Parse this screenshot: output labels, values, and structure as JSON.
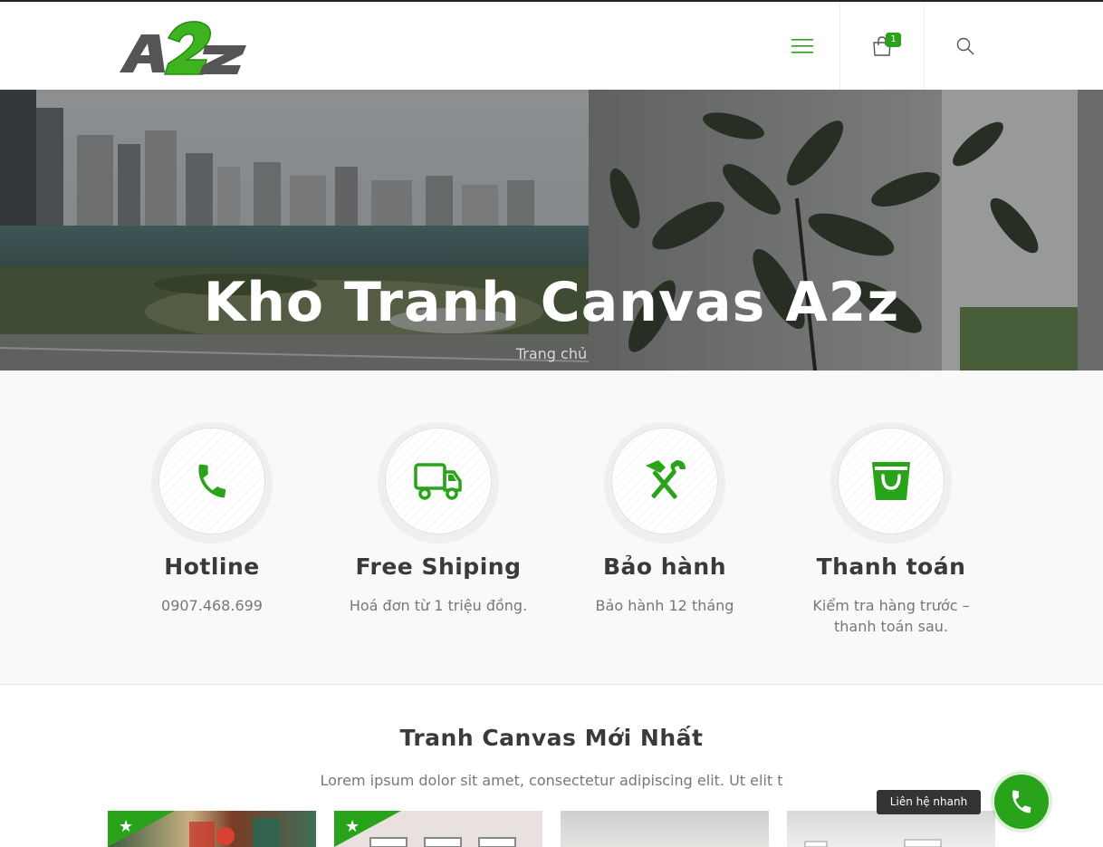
{
  "header": {
    "logo_text": "A2z",
    "menu_icon": "hamburger-icon",
    "cart_icon": "shopping-bag-icon",
    "cart_count": "1",
    "search_icon": "search-icon"
  },
  "hero": {
    "title": "Kho Tranh Canvas A2z",
    "breadcrumb": "Trang chủ"
  },
  "features": [
    {
      "icon": "phone-icon",
      "title": "Hotline",
      "text": "0907.468.699"
    },
    {
      "icon": "truck-icon",
      "title": "Free Shiping",
      "text": "Hoá đơn từ 1 triệu đồng."
    },
    {
      "icon": "tools-icon",
      "title": "Bảo hành",
      "text": "Bảo hành 12 tháng"
    },
    {
      "icon": "shopping-bag-icon",
      "title": "Thanh toán",
      "text": "Kiểm tra hàng trước – thanh toán sau."
    }
  ],
  "products_section": {
    "title": "Tranh Canvas Mới Nhất",
    "subtitle": "Lorem ipsum dolor sit amet, consectetur adipiscing elit. Ut elit t",
    "badge_icon": "star-icon"
  },
  "quick_contact": {
    "label": "Liên hệ nhanh",
    "icon": "phone-icon"
  },
  "colors": {
    "accent": "#29a31a",
    "text_dark": "#3a3a3a",
    "text_muted": "#777777"
  }
}
